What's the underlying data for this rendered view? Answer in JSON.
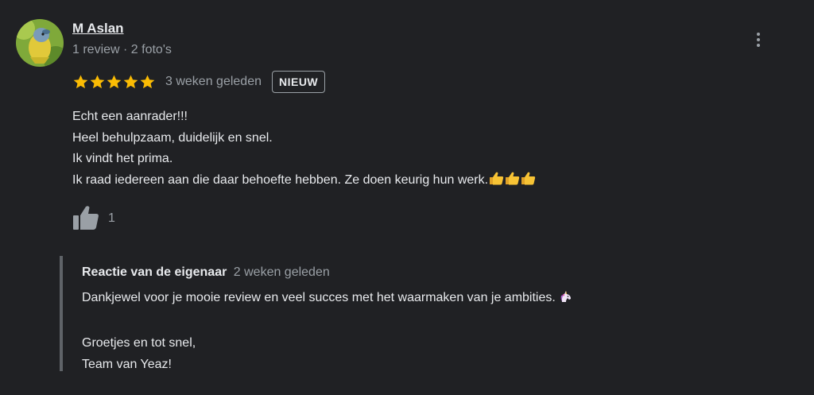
{
  "reviewer": {
    "name": "M Aslan",
    "meta": "1 review · 2 foto's"
  },
  "rating": {
    "stars": 5,
    "max": 5,
    "date": "3 weken geleden",
    "badge": "NIEUW"
  },
  "review": {
    "lines": [
      "Echt een aanrader!!!",
      "Heel behulpzaam, duidelijk en snel.",
      "Ik vindt het prima.",
      "Ik raad iedereen aan die daar behoefte hebben. Ze doen keurig hun werk."
    ],
    "trailing_icons": [
      "thumbs-up-emoji",
      "thumbs-up-emoji",
      "thumbs-up-emoji"
    ]
  },
  "likes": {
    "count": "1",
    "icon": "thumbs-up-icon"
  },
  "owner_reply": {
    "title": "Reactie van de eigenaar",
    "date": "2 weken geleden",
    "line1": "Dankjewel voor je mooie review en veel succes met het waarmaken van je ambities.",
    "line1_icon": "unicorn-emoji",
    "line2": "Groetjes en tot snel,",
    "line3": "Team van Yeaz!"
  },
  "colors": {
    "background": "#202124",
    "text": "#e8eaed",
    "secondary_text": "#9aa0a6",
    "star": "#fbbc04",
    "reply_border": "#5f6368"
  }
}
